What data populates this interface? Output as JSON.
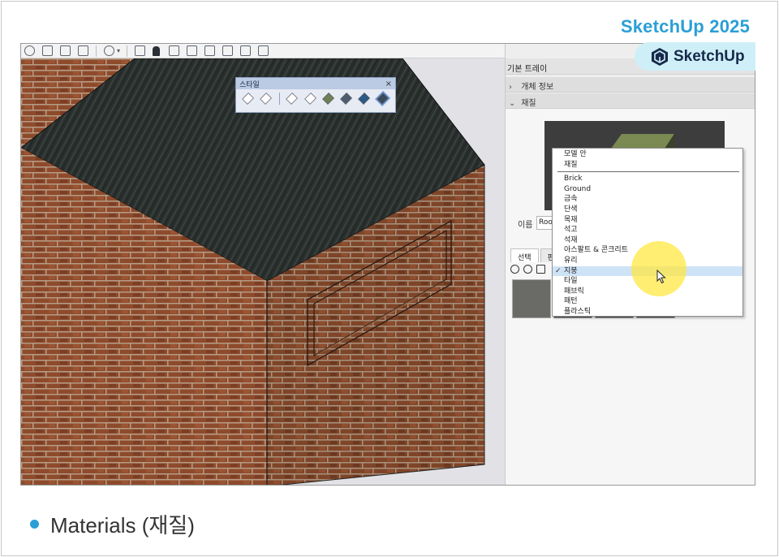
{
  "brand": {
    "title": "SketchUp 2025",
    "badge_text": "SketchUp",
    "accent": "#2a9fd6"
  },
  "styles_toolbar": {
    "title": "스타일",
    "close": "×"
  },
  "tray": {
    "title": "기본 트레이",
    "entity_info": "개체 정보",
    "materials": "재질",
    "name_label": "이름",
    "name_value": "Roof",
    "tabs": [
      "선택",
      "편"
    ]
  },
  "dropdown": {
    "items": [
      {
        "label": "모델 안",
        "checked": false,
        "highlighted": false
      },
      {
        "label": "재질",
        "checked": false,
        "highlighted": false
      }
    ],
    "categories": [
      {
        "label": "Brick",
        "checked": false,
        "highlighted": false
      },
      {
        "label": "Ground",
        "checked": false,
        "highlighted": false
      },
      {
        "label": "금속",
        "checked": false,
        "highlighted": false
      },
      {
        "label": "단색",
        "checked": false,
        "highlighted": false
      },
      {
        "label": "목재",
        "checked": false,
        "highlighted": false
      },
      {
        "label": "석고",
        "checked": false,
        "highlighted": false
      },
      {
        "label": "석재",
        "checked": false,
        "highlighted": false
      },
      {
        "label": "아스팔트 & 콘크리트",
        "checked": false,
        "highlighted": false
      },
      {
        "label": "유리",
        "checked": false,
        "highlighted": false
      },
      {
        "label": "지붕",
        "checked": true,
        "highlighted": true
      },
      {
        "label": "타일",
        "checked": false,
        "highlighted": false
      },
      {
        "label": "패브릭",
        "checked": false,
        "highlighted": false
      },
      {
        "label": "패턴",
        "checked": false,
        "highlighted": false
      },
      {
        "label": "플라스틱",
        "checked": false,
        "highlighted": false
      }
    ],
    "check_mark": "✓"
  },
  "caption": {
    "text": "Materials (재질)"
  },
  "icons": {
    "toolbar": [
      "orbit-icon",
      "pan-icon",
      "zoom-icon",
      "zoom-extents-icon",
      "position-camera-icon",
      "section-plane-icon",
      "person-icon",
      "iso-view-icon",
      "top-view-icon",
      "front-view-icon",
      "right-view-icon",
      "back-view-icon",
      "left-view-icon"
    ],
    "styles": [
      "xray-icon",
      "backedges-icon",
      "wireframe-icon",
      "hidden-line-icon",
      "shaded-icon",
      "shaded-textures-icon",
      "monochrome-icon",
      "active-style-icon"
    ]
  }
}
